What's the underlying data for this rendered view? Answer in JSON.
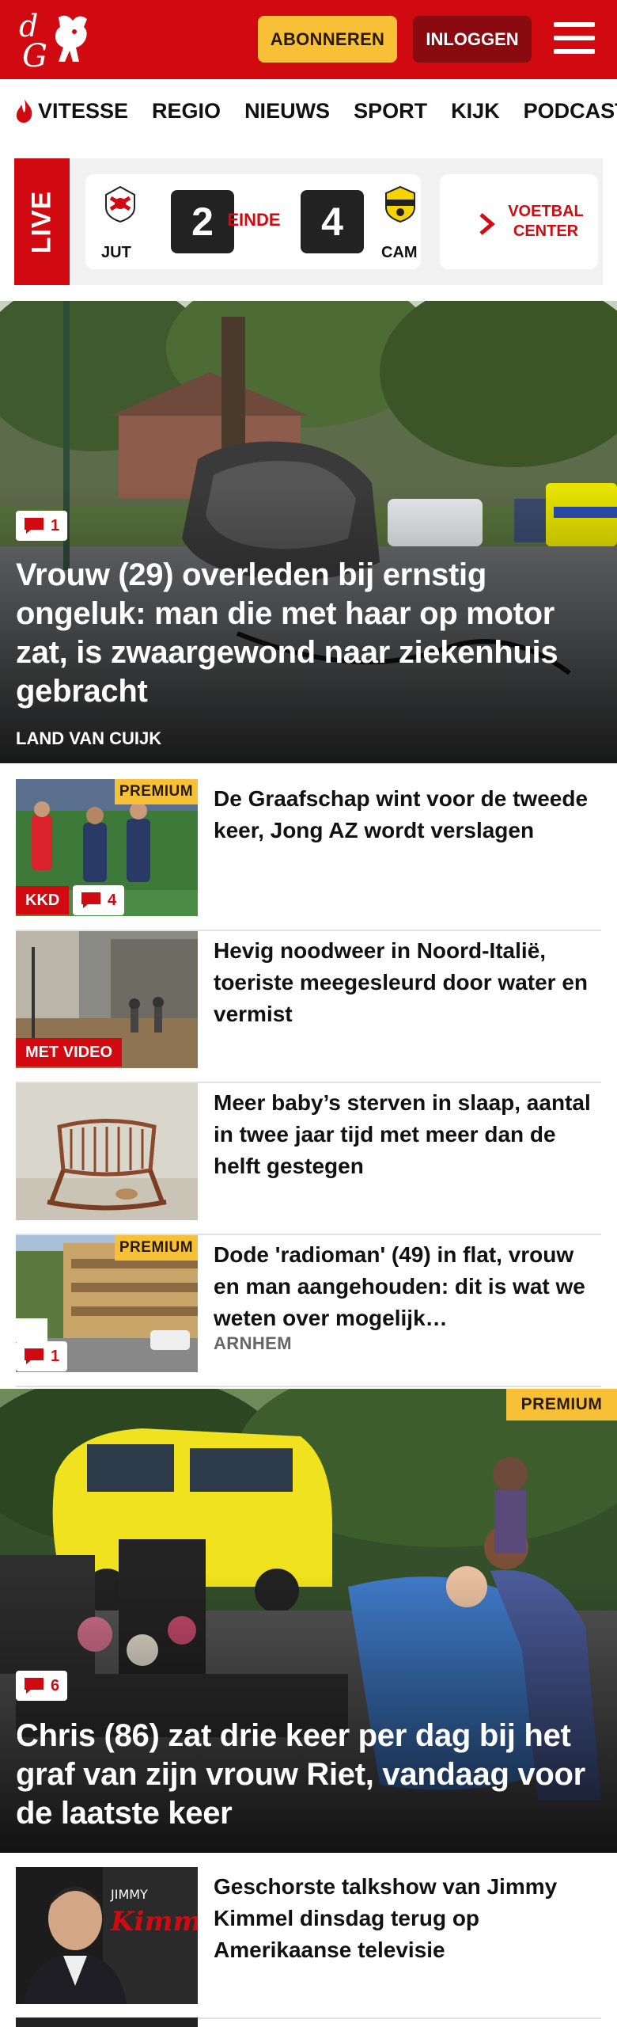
{
  "header": {
    "logo": "dG",
    "subscribe": "ABONNEREN",
    "login": "INLOGGEN"
  },
  "nav": [
    "VITESSE",
    "REGIO",
    "NIEUWS",
    "SPORT",
    "KIJK",
    "PODCAST"
  ],
  "live": {
    "tag": "LIVE",
    "home": "JUT",
    "away": "CAM",
    "home_score": "2",
    "away_score": "4",
    "status": "EINDE",
    "cta": "VOETBAL CENTER"
  },
  "hero1": {
    "comments": "1",
    "title": "Vrouw (29) overleden bij ernstig ongeluk: man die met haar op motor zat, is zwaargewond naar ziekenhuis gebracht",
    "location": "LAND VAN CUIJK"
  },
  "articles": [
    {
      "title": "De Graafschap wint voor de tweede keer, Jong AZ wordt verslagen",
      "premium": "PREMIUM",
      "tag": "KKD",
      "comments": "4"
    },
    {
      "title": "Hevig noodweer in Noord-Italië, toeriste meegesleurd door water en vermist",
      "tag": "MET VIDEO"
    },
    {
      "title": "Meer baby’s sterven in slaap, aantal in twee jaar tijd met meer dan de helft gestegen"
    },
    {
      "title": "Dode 'radioman' (49) in flat, vrouw en man aangehouden: dit is wat we weten over mogelijk…",
      "premium": "PREMIUM",
      "comments": "1",
      "location": "ARNHEM"
    }
  ],
  "hero2": {
    "premium": "PREMIUM",
    "comments": "6",
    "title": "Chris (86) zat drie keer per dag bij het graf van zijn vrouw Riet, vandaag voor de laatste keer"
  },
  "article5": {
    "title": "Geschorste talkshow van Jimmy Kimmel dinsdag terug op Amerikaanse televisie"
  },
  "colors": {
    "brand": "#d10a11",
    "premium": "#f7c036"
  }
}
